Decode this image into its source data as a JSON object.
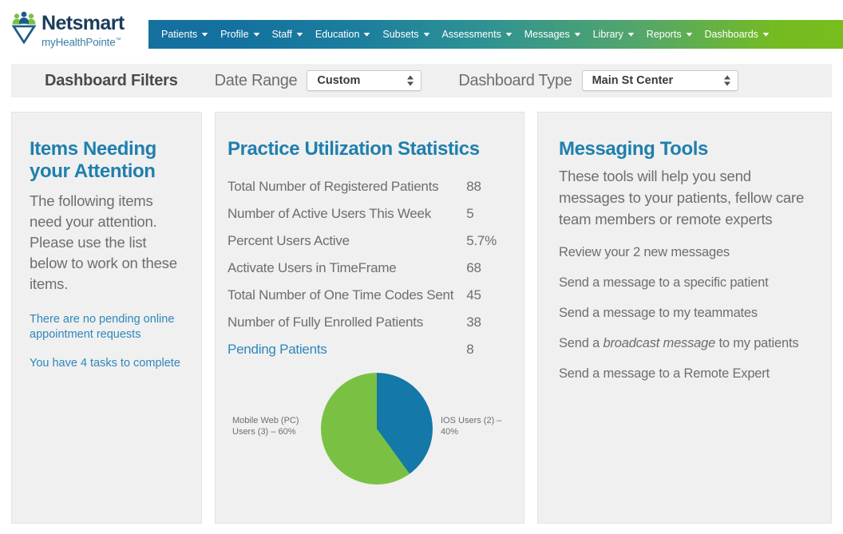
{
  "brand": {
    "name": "Netsmart",
    "product": "myHealthPointe",
    "trademark": "™",
    "logo_icon": "netsmart-people-logo",
    "nav_gradient_start": "#14719f",
    "nav_gradient_end": "#79bd1d",
    "accent_blue": "#1f7fae",
    "link_blue": "#2e87bb",
    "text_gray": "#6d6e71",
    "panel_bg": "#f0f0f0"
  },
  "nav": {
    "items": [
      {
        "label": "Patients",
        "caret": "▼"
      },
      {
        "label": "Profile",
        "caret": "▼"
      },
      {
        "label": "Staff",
        "caret": "▼"
      },
      {
        "label": "Education",
        "caret": "▼"
      },
      {
        "label": "Subsets",
        "caret": "▼"
      },
      {
        "label": "Assessments",
        "caret": "▼"
      },
      {
        "label": "Messages",
        "caret": "▼"
      },
      {
        "label": "Library",
        "caret": "▼"
      },
      {
        "label": "Reports",
        "caret": "▼"
      },
      {
        "label": "Dashboards",
        "caret": "▼"
      }
    ]
  },
  "filters": {
    "title": "Dashboard Filters",
    "date_range_label": "Date Range",
    "date_range_value": "Custom",
    "dashboard_type_label": "Dashboard Type",
    "dashboard_type_value": "Main St Center"
  },
  "attention_panel": {
    "title_line1": "Items Needing",
    "title_line2": "your Attention",
    "body": "The following items need your attention. Please use the list below to work on these items.",
    "links": [
      "There are no pending online appointment requests",
      "You have 4 tasks to complete"
    ]
  },
  "stats_panel": {
    "title": "Practice Utilization Statistics",
    "rows": [
      {
        "label": "Total Number of Registered Patients",
        "value": "88",
        "is_link": false
      },
      {
        "label": "Number of Active Users This Week",
        "value": "5",
        "is_link": false
      },
      {
        "label": "Percent Users Active",
        "value": "5.7%",
        "is_link": false
      },
      {
        "label": "Activate Users in TimeFrame",
        "value": "68",
        "is_link": false
      },
      {
        "label": "Total Number of One Time Codes Sent",
        "value": "45",
        "is_link": false
      },
      {
        "label": "Number of Fully Enrolled Patients",
        "value": "38",
        "is_link": false
      },
      {
        "label": "Pending Patients",
        "value": "8",
        "is_link": true
      }
    ]
  },
  "messaging_panel": {
    "title": "Messaging Tools",
    "body": "These tools will help you send messages to your patients, fellow care team members or remote experts",
    "items": [
      {
        "pre": "Review your 2 new messages",
        "em": "",
        "post": ""
      },
      {
        "pre": "Send a message to a specific patient",
        "em": "",
        "post": ""
      },
      {
        "pre": "Send a message to my teammates",
        "em": "",
        "post": ""
      },
      {
        "pre": "Send a ",
        "em": "broadcast message",
        "post": " to my patients"
      },
      {
        "pre": "Send a message to a Remote Expert",
        "em": "",
        "post": ""
      }
    ]
  },
  "chart_data": {
    "type": "pie",
    "title": "",
    "categories": [
      "IOS Users",
      "Mobile Web (PC) Users"
    ],
    "values": [
      2,
      3
    ],
    "percentages": [
      40,
      60
    ],
    "labels": [
      "IOS Users (2) – 40%",
      "Mobile Web (PC) Users (3) – 60%"
    ],
    "colors": [
      "#1478a8",
      "#7ac143"
    ],
    "legend": "inline-labels",
    "start_angle_deg": 0
  }
}
